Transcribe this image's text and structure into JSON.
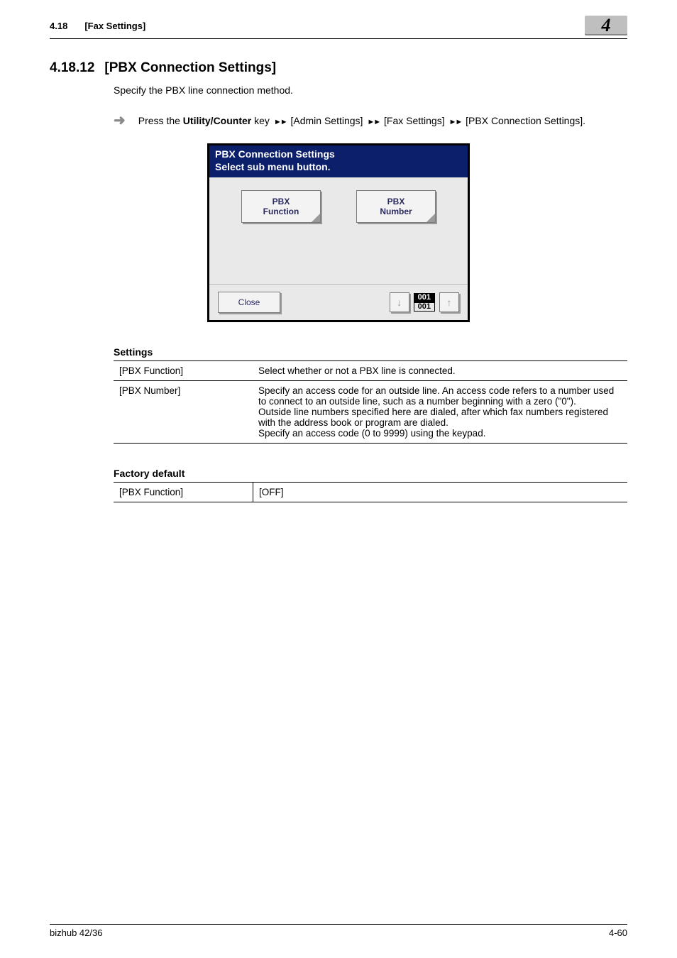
{
  "header": {
    "section_number": "4.18",
    "section_title": "[Fax Settings]",
    "chapter_badge": "4"
  },
  "heading": {
    "number": "4.18.12",
    "title": "[PBX Connection Settings]"
  },
  "intro": "Specify the PBX line connection method.",
  "step": {
    "prefix": "Press the ",
    "bold": "Utility/Counter",
    "after_bold": " key ",
    "crumb1": "[Admin Settings]",
    "crumb2": "[Fax Settings]",
    "crumb3": "[PBX Connection Settings]."
  },
  "device": {
    "title_line1": "PBX Connection Settings",
    "title_line2": "Select sub menu button.",
    "btn1_line1": "PBX",
    "btn1_line2": "Function",
    "btn2_line1": "PBX",
    "btn2_line2": "Number",
    "close": "Close",
    "page_top": "001",
    "page_bottom": "001"
  },
  "settings_label": "Settings",
  "settings_rows": {
    "r1c1": "[PBX Function]",
    "r1c2": "Select whether or not a PBX line is connected.",
    "r2c1": "[PBX Number]",
    "r2c2": "Specify an access code for an outside line. An access code refers to a number used to connect to an outside line, such as a number beginning with a zero (\"0\").\nOutside line numbers specified here are dialed, after which fax numbers registered with the address book or program are dialed.\nSpecify an access code (0 to 9999) using the keypad."
  },
  "factory_label": "Factory default",
  "factory_rows": {
    "r1c1": "[PBX Function]",
    "r1c2": "[OFF]"
  },
  "footer": {
    "left": "bizhub 42/36",
    "right": "4-60"
  }
}
